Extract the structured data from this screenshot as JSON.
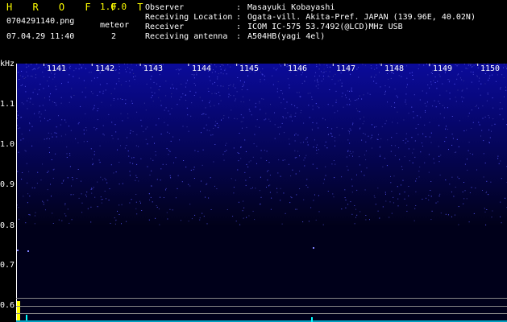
{
  "header": {
    "app_title": "H R O F F T",
    "version": "1.0.0",
    "filename": "0704291140.png",
    "meteor_label": "meteor",
    "datetime": "07.04.29 11:40",
    "meteor_count": "2"
  },
  "info": [
    {
      "key": "Observer",
      "value": "Masayuki Kobayashi"
    },
    {
      "key": "Receiving Location",
      "value": "Ogata-vill. Akita-Pref. JAPAN (139.96E, 40.02N)"
    },
    {
      "key": "Receiver",
      "value": "ICOM IC-575 53.7492(@LCD)MHz USB"
    },
    {
      "key": "Receiving antenna",
      "value": "A504HB(yagi 4el)"
    }
  ],
  "axis": {
    "unit": "kHz",
    "y_ticks": [
      "1.1",
      "1.0",
      "0.9",
      "0.8",
      "0.7",
      "0.6"
    ],
    "x_ticks": [
      "1141",
      "1142",
      "1143",
      "1144",
      "1145",
      "1146",
      "1147",
      "1148",
      "1149",
      "1150"
    ]
  },
  "colors": {
    "title": "#ffff00",
    "noise": "#1010a0",
    "signal": "#ffff00",
    "echo": "#00ffff"
  }
}
